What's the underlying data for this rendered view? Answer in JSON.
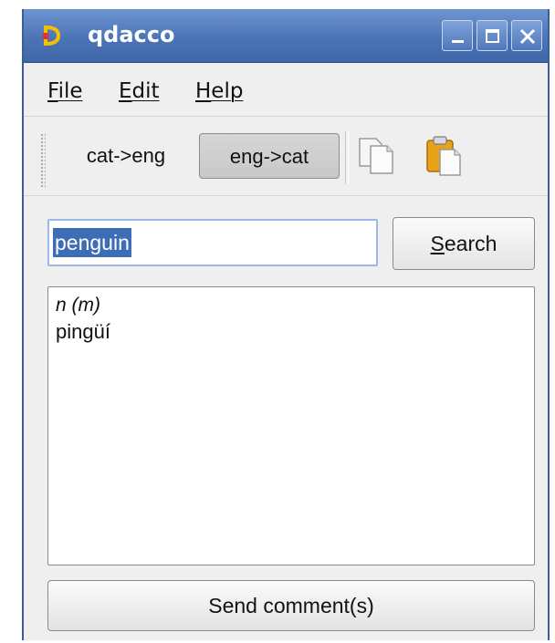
{
  "window": {
    "title": "qdacco",
    "controls": {
      "minimize": "minimize-icon",
      "maximize": "maximize-icon",
      "close": "close-icon"
    },
    "accent_color": "#4b74b6"
  },
  "menu": {
    "items": [
      {
        "label": "File"
      },
      {
        "label": "Edit"
      },
      {
        "label": "Help"
      }
    ]
  },
  "toolbar": {
    "cat_eng_label": "cat->eng",
    "eng_cat_label": "eng->cat",
    "active_direction": "eng->cat",
    "copy_icon": "copy-icon",
    "paste_icon": "paste-icon"
  },
  "search": {
    "value": "penguin",
    "button_label": "Search",
    "button_mnemonic": "S",
    "button_rest": "earch"
  },
  "result": {
    "part_of_speech": "n (m)",
    "translation": "pingüí"
  },
  "footer": {
    "send_label": "Send comment(s)"
  }
}
